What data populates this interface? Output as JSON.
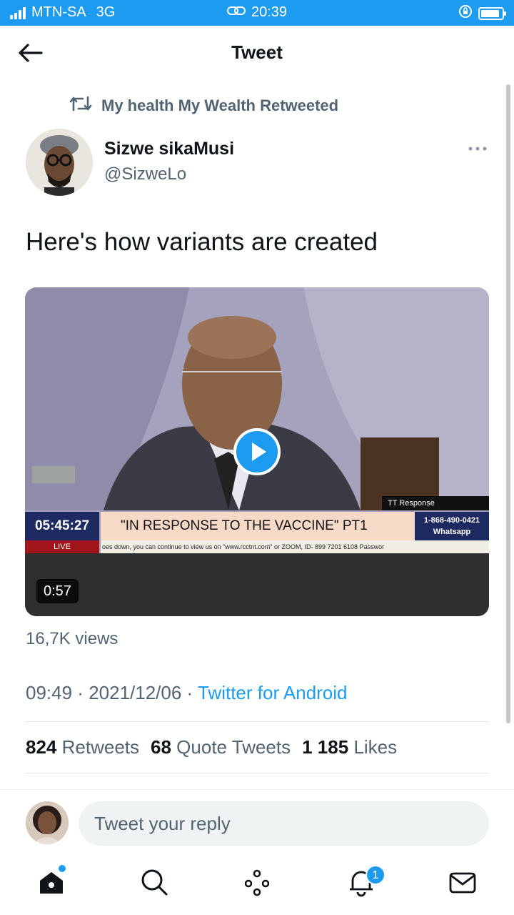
{
  "status_bar": {
    "carrier": "MTN-SA",
    "network": "3G",
    "time": "20:39",
    "battery_level": 0.9,
    "icons": [
      "signal-icon",
      "link-icon",
      "orientation-lock-icon",
      "battery-icon"
    ]
  },
  "header": {
    "title": "Tweet",
    "back_icon": "arrow-left-icon"
  },
  "retweet_context": {
    "icon": "retweet-icon",
    "text": "My health My Wealth Retweeted"
  },
  "author": {
    "name": "Sizwe sikaMusi",
    "handle": "@SizweLo",
    "more_icon": "more-options-icon"
  },
  "tweet": {
    "text": "Here's how variants are created"
  },
  "video": {
    "duration": "0:57",
    "play_icon": "play-icon",
    "overlay": {
      "label": "TT Response",
      "clock": "05:45:27",
      "live": "LIVE",
      "headline": "\"IN RESPONSE TO THE VACCINE\" PT1",
      "phone": "1-868-490-0421",
      "phone_sub": "Whatsapp",
      "ticker": "oes down, you can continue to view us on \"www.rcctnt.com\" or ZOOM, ID- 899 7201 6108 Passwor"
    }
  },
  "views": "16,7K views",
  "meta": {
    "time": "09:49",
    "sep1": " · ",
    "date": "2021/12/06",
    "sep2": " · ",
    "source": "Twitter for Android"
  },
  "stats": {
    "retweets_count": "824",
    "retweets_label": "Retweets",
    "quotes_count": "68",
    "quotes_label": "Quote Tweets",
    "likes_count": "1 185",
    "likes_label": "Likes"
  },
  "reply": {
    "placeholder": "Tweet your reply"
  },
  "bottom_nav": {
    "items": [
      "home-icon",
      "search-icon",
      "spaces-icon",
      "notifications-icon",
      "messages-icon"
    ],
    "notifications_badge": "1"
  },
  "colors": {
    "accent": "#1d9bf0",
    "text_primary": "#0f1419",
    "text_secondary": "#536471"
  }
}
